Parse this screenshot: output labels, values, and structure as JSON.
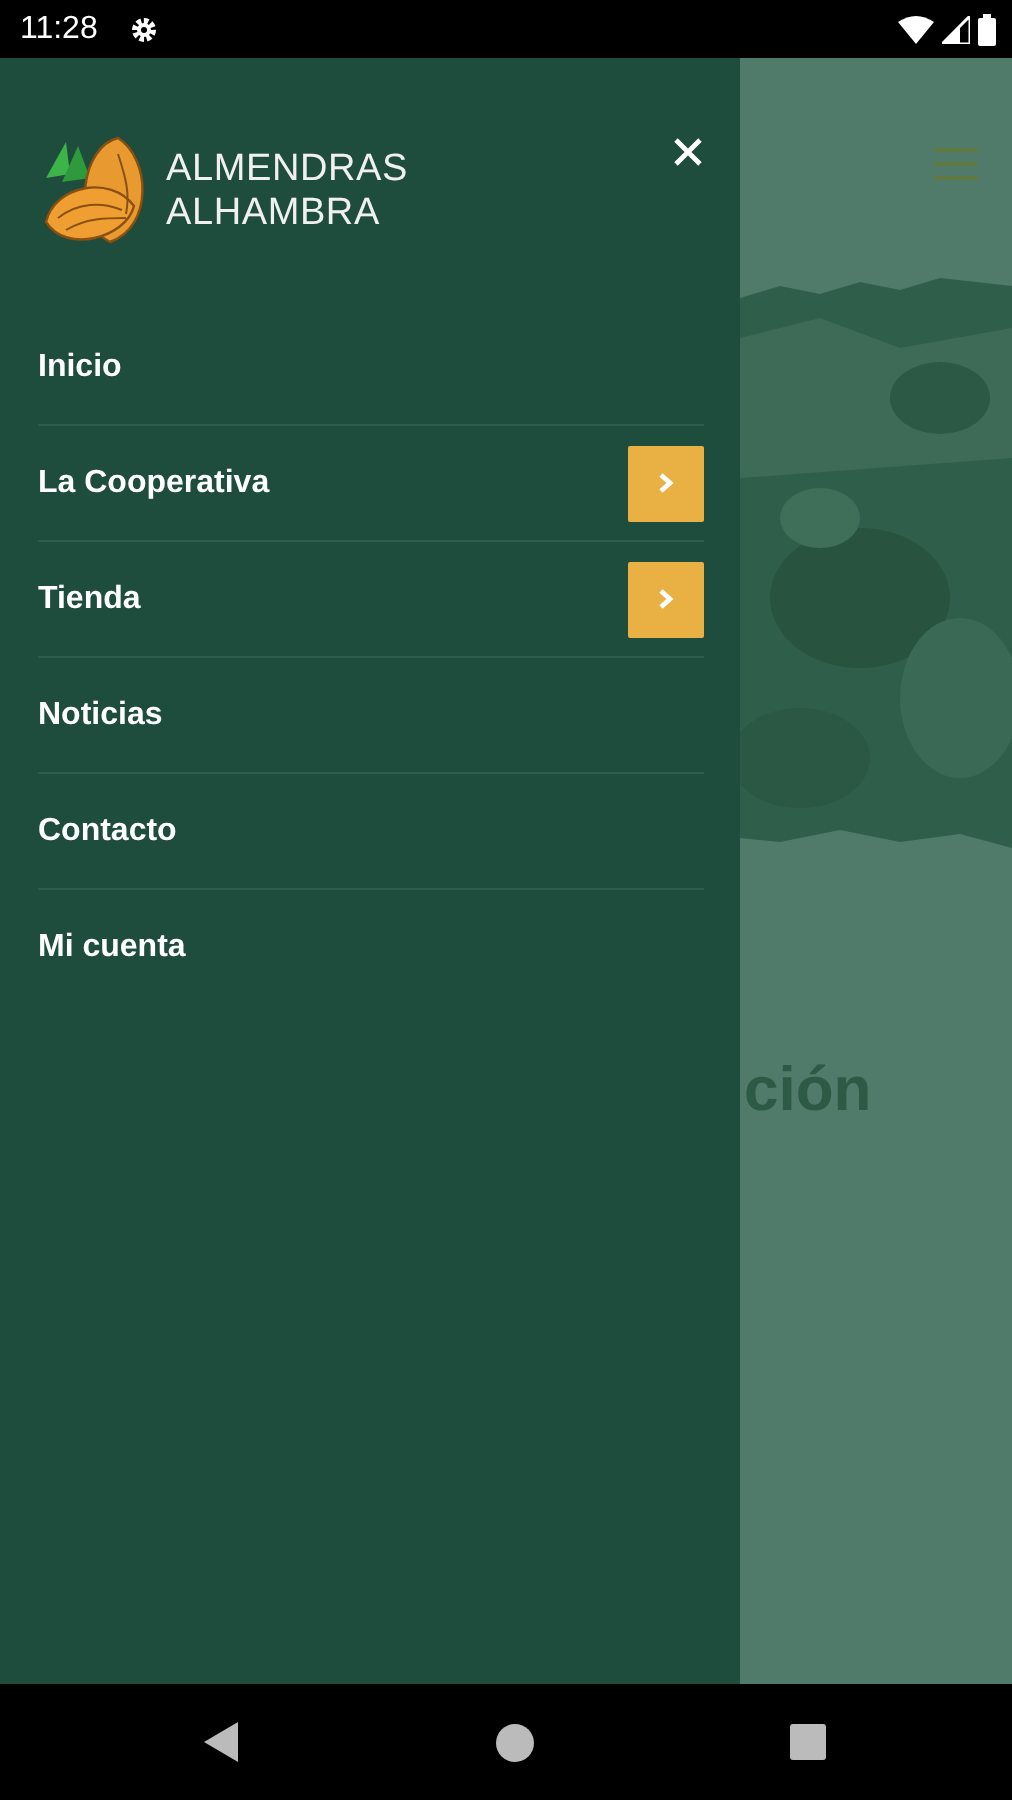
{
  "status_bar": {
    "time": "11:28"
  },
  "drawer": {
    "brand": [
      "ALMENDRAS",
      "ALHAMBRA"
    ],
    "menu": [
      {
        "label": "Inicio",
        "has_submenu": false
      },
      {
        "label": "La Cooperativa",
        "has_submenu": true
      },
      {
        "label": "Tienda",
        "has_submenu": true
      },
      {
        "label": "Noticias",
        "has_submenu": false
      },
      {
        "label": "Contacto",
        "has_submenu": false
      },
      {
        "label": "Mi cuenta",
        "has_submenu": false
      }
    ]
  },
  "page": {
    "heading": "ción"
  }
}
